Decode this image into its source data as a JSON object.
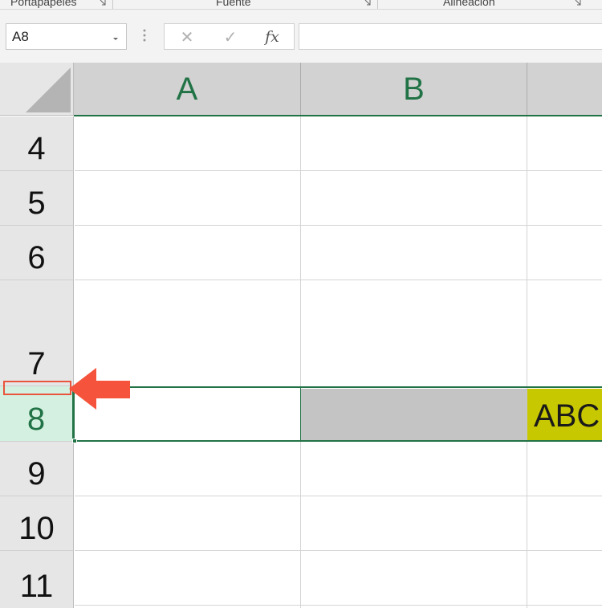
{
  "ribbon": {
    "groups": [
      "Portapapeles",
      "Fuente",
      "Alineación"
    ]
  },
  "formula_bar": {
    "name_box": "A8",
    "cancel_symbol": "✕",
    "enter_symbol": "✓",
    "function_symbol": "fx",
    "formula": ""
  },
  "columns": [
    "A",
    "B"
  ],
  "rows": [
    "4",
    "5",
    "6",
    "7",
    "8",
    "9",
    "10",
    "11"
  ],
  "selected": {
    "row": "8",
    "cell": "A8"
  },
  "cells": {
    "C8": "ABC"
  },
  "colors": {
    "accent": "#217346",
    "b8_fill": "#c4c4c4",
    "c8_fill": "#c8c800",
    "annotation": "#f5533b"
  }
}
